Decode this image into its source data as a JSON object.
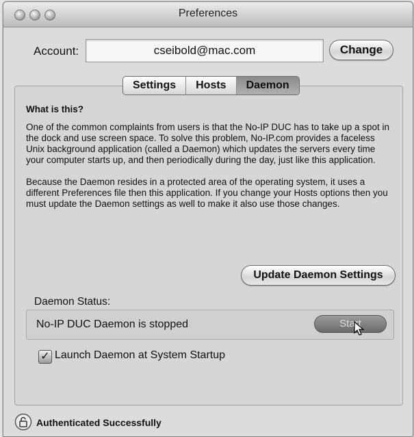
{
  "window": {
    "title": "Preferences"
  },
  "account": {
    "label": "Account:",
    "value": "cseibold@mac.com",
    "change_label": "Change"
  },
  "tabs": [
    {
      "label": "Settings"
    },
    {
      "label": "Hosts"
    },
    {
      "label": "Daemon",
      "active": true
    }
  ],
  "daemon": {
    "heading": "What is this?",
    "paragraph1": "One of the common complaints from users is that the No-IP DUC has to take up a spot in the dock and use screen space.  To solve this problem, No-IP.com provides a faceless Unix background application (called a Daemon) which updates the servers every time your computer starts up, and then periodically during the day, just like this application.",
    "paragraph2": "Because the Daemon resides in a protected area of the operating system, it uses a different Preferences file then this application.  If you change your Hosts options then you must update the Daemon settings as well to make it also use those changes.",
    "update_label": "Update Daemon Settings",
    "status_label": "Daemon Status:",
    "status_text": "No-IP DUC Daemon is stopped",
    "start_label": "Start",
    "launch_label": "Launch Daemon at System Startup",
    "launch_checked": true
  },
  "footer": {
    "status": "Authenticated Successfully",
    "icon": "lock-icon"
  }
}
